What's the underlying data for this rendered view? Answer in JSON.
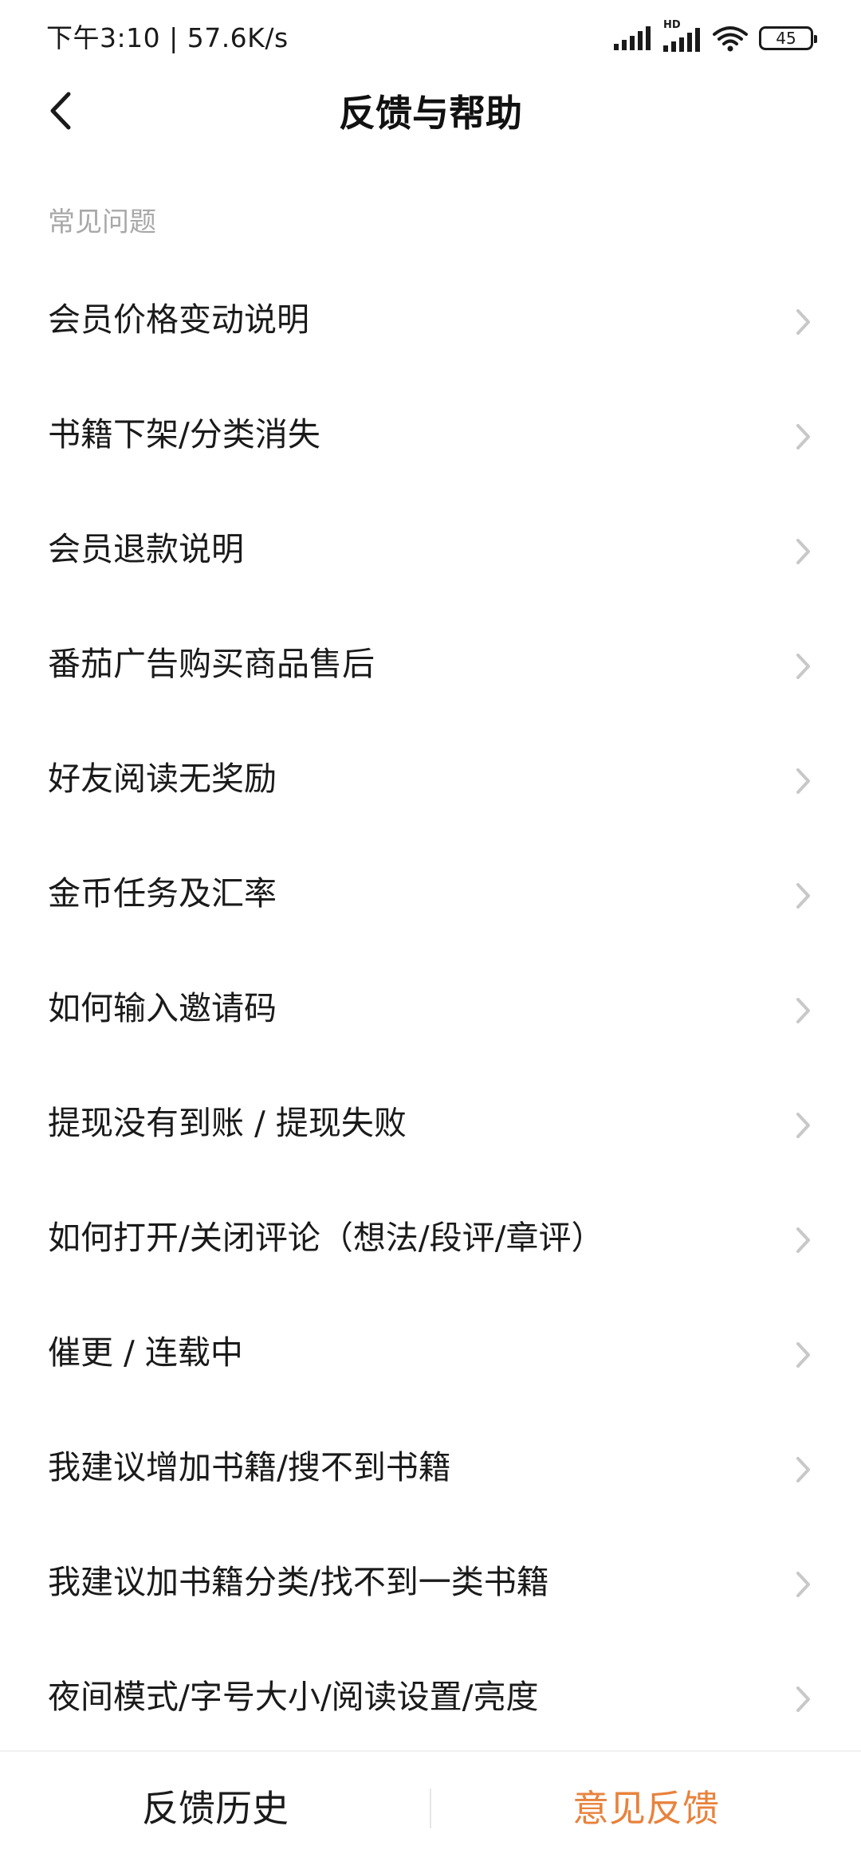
{
  "status_bar": {
    "time_speed": "下午3:10 | 57.6K/s",
    "network_label": "HD",
    "battery_level": "45",
    "icons": [
      "signal-icon",
      "hd-signal-icon",
      "wifi-icon",
      "battery-icon"
    ]
  },
  "nav": {
    "back_icon": "chevron-left-icon",
    "title": "反馈与帮助"
  },
  "faq": {
    "section_title": "常见问题",
    "items": [
      {
        "label": "会员价格变动说明"
      },
      {
        "label": "书籍下架/分类消失"
      },
      {
        "label": "会员退款说明"
      },
      {
        "label": "番茄广告购买商品售后"
      },
      {
        "label": "好友阅读无奖励"
      },
      {
        "label": "金币任务及汇率"
      },
      {
        "label": "如何输入邀请码"
      },
      {
        "label": "提现没有到账 / 提现失败"
      },
      {
        "label": "如何打开/关闭评论（想法/段评/章评）"
      },
      {
        "label": "催更 / 连载中"
      },
      {
        "label": "我建议增加书籍/搜不到书籍"
      },
      {
        "label": "我建议加书籍分类/找不到一类书籍"
      },
      {
        "label": "夜间模式/字号大小/阅读设置/亮度"
      }
    ],
    "item_icon": "chevron-right-icon"
  },
  "bottom_bar": {
    "history_label": "反馈历史",
    "feedback_label": "意见反馈"
  },
  "colors": {
    "accent": "#e8823c",
    "section_title": "#a8a8a8",
    "text": "#1a1a1a",
    "chevron": "#c8c8c8"
  }
}
